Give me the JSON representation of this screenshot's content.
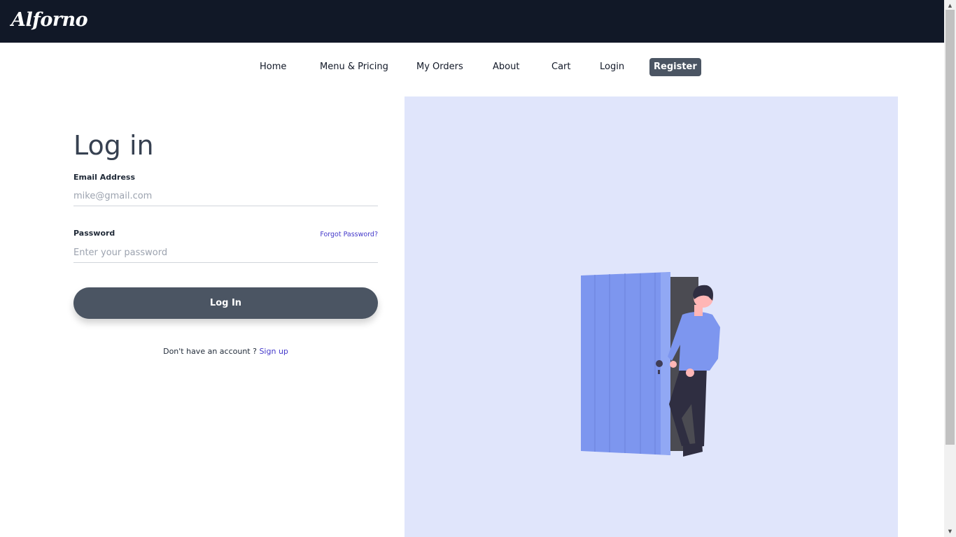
{
  "brand": {
    "logo_text": "Alforno"
  },
  "nav": {
    "items": [
      {
        "label": "Home"
      },
      {
        "label": "Menu & Pricing"
      },
      {
        "label": "My Orders"
      },
      {
        "label": "About"
      },
      {
        "label": "Cart"
      },
      {
        "label": "Login"
      },
      {
        "label": "Register"
      }
    ]
  },
  "login_form": {
    "title": "Log in",
    "email_label": "Email Address",
    "email_placeholder": "mike@gmail.com",
    "email_value": "",
    "password_label": "Password",
    "password_placeholder": "Enter your password",
    "password_value": "",
    "forgot_label": "Forgot Password?",
    "submit_label": "Log In",
    "signup_prompt": "Don't have an account ?",
    "signup_link": "Sign up"
  },
  "illustration": {
    "icon": "person-opening-door-illustration"
  },
  "colors": {
    "topbar": "#111827",
    "accent_button": "#4b5563",
    "link": "#4338ca",
    "illustration_bg": "#e0e5fb",
    "door": "#7d96ef"
  }
}
